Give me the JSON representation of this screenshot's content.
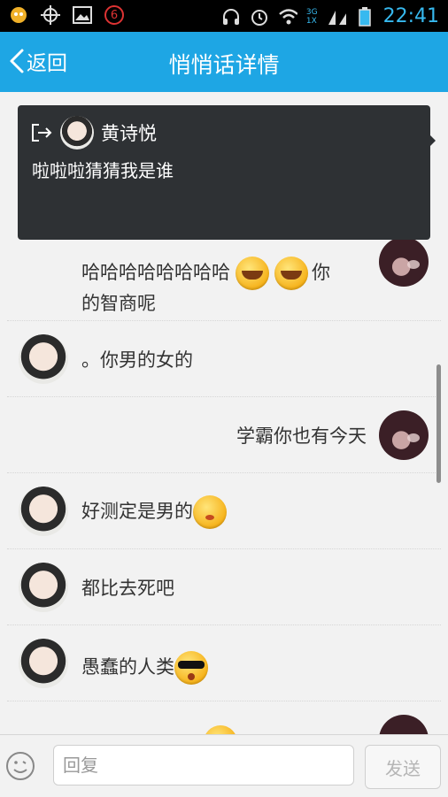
{
  "status_bar": {
    "notification_count": "6",
    "time": "22:41",
    "network_labels": [
      "3G",
      "1X"
    ],
    "signal_labels": [
      "1",
      "2"
    ],
    "left_icons": [
      "app-icon",
      "location-icon",
      "gallery-icon",
      "badge-icon"
    ],
    "right_icons": [
      "headset-icon",
      "alarm-icon",
      "wifi-icon",
      "signal-icon",
      "battery-icon"
    ]
  },
  "header": {
    "back_label": "返回",
    "title": "悄悄话详情"
  },
  "overlay": {
    "name": "黄诗悦",
    "message": "啦啦啦猜猜我是谁"
  },
  "messages": [
    {
      "side": "right",
      "avatar": "anime",
      "text": "哈哈哈哈哈哈哈哈",
      "emojis": [
        "cry",
        "cry"
      ],
      "text_after": "你",
      "line2": "的智商呢"
    },
    {
      "side": "left",
      "avatar": "male",
      "text": "。你男的女的"
    },
    {
      "side": "right",
      "avatar": "anime",
      "text": "学霸你也有今天"
    },
    {
      "side": "left",
      "avatar": "male",
      "text": "好测定是男的",
      "emoji": "kiss"
    },
    {
      "side": "left",
      "avatar": "male",
      "text": "都比去死吧"
    },
    {
      "side": "left",
      "avatar": "male",
      "text": "愚蠢的人类",
      "emoji": "cool"
    }
  ],
  "composer": {
    "placeholder": "回复",
    "send_label": "发送"
  },
  "colors": {
    "header": "#1ea6e4",
    "time": "#37b9ef",
    "overlay": "#2e3134"
  }
}
